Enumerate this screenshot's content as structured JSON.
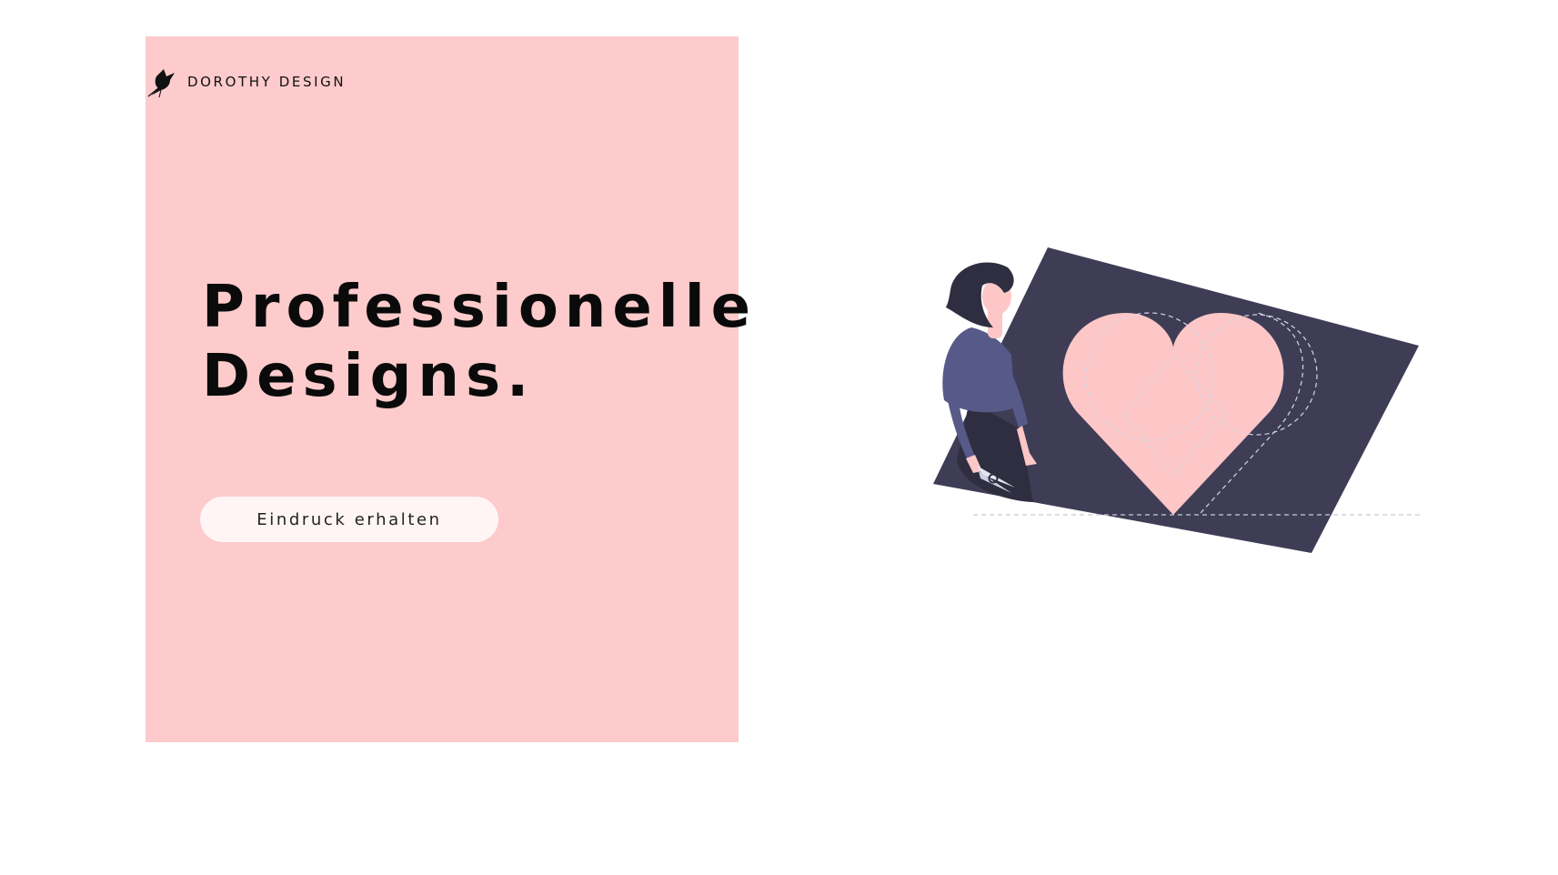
{
  "brand": {
    "name": "DOROTHY DESIGN",
    "logo_icon": "hummingbird-icon"
  },
  "hero": {
    "headline_line1": "Professionelle",
    "headline_line2": "Designs.",
    "cta_label": "Eindruck erhalten"
  },
  "illustration": {
    "subject": "woman-cutting-heart-illustration"
  },
  "colors": {
    "panel_pink": "#fdcbcb",
    "heart_pink": "#fdc7c7",
    "dark_navy": "#3f3d56",
    "jacket_purple": "#575a89",
    "button_bg": "#fff5f5",
    "text_dark": "#0a0a0a"
  }
}
